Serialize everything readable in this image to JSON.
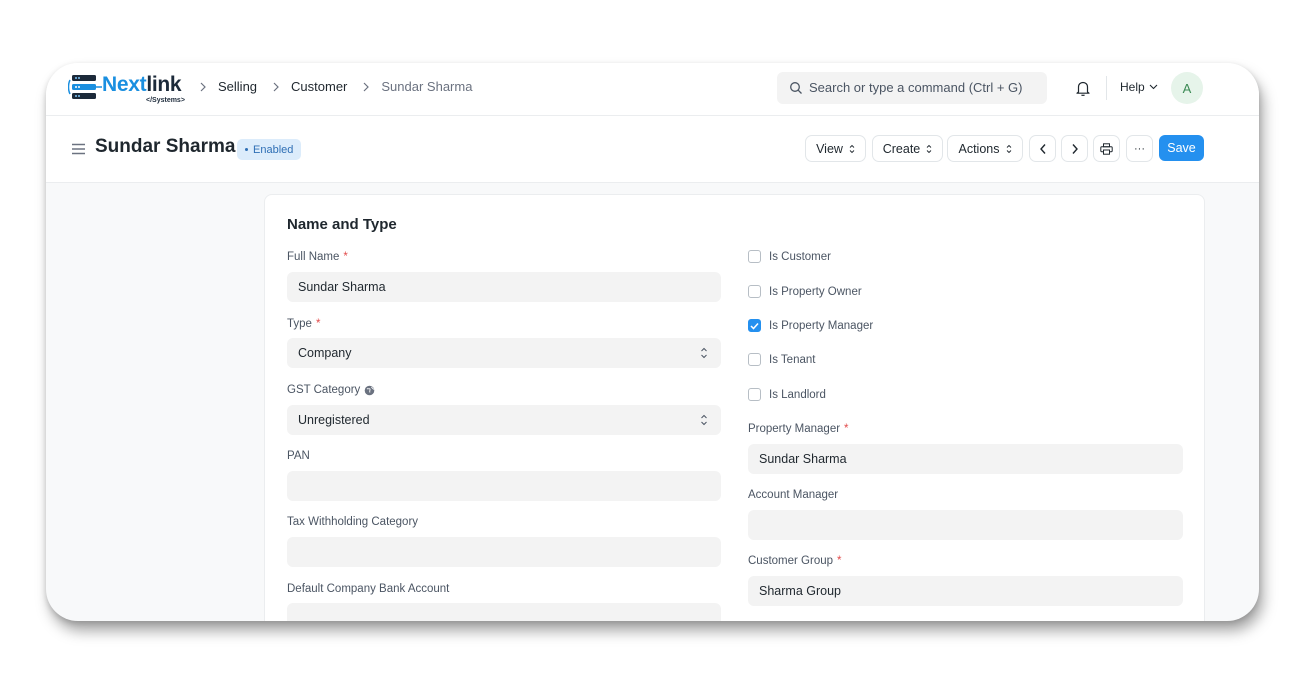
{
  "brand": {
    "name_part1": "Next",
    "name_part2": "link",
    "subtitle": "</Systems>"
  },
  "breadcrumbs": [
    "Selling",
    "Customer",
    "Sundar Sharma"
  ],
  "search": {
    "placeholder": "Search or type a command (Ctrl + G)"
  },
  "navbar": {
    "help_label": "Help",
    "avatar_initial": "A"
  },
  "page": {
    "title": "Sundar Sharma",
    "status": "Enabled",
    "buttons": {
      "view": "View",
      "create": "Create",
      "actions": "Actions",
      "more": "···",
      "save": "Save"
    }
  },
  "form": {
    "section_title": "Name and Type",
    "left_fields": [
      {
        "label": "Full Name",
        "required": true,
        "value": "Sundar Sharma"
      },
      {
        "label": "Type",
        "required": true,
        "value": "Company"
      },
      {
        "label": "GST Category",
        "value": "Unregistered"
      },
      {
        "label": "PAN",
        "value": ""
      },
      {
        "label": "Tax Withholding Category",
        "value": ""
      },
      {
        "label": "Default Company Bank Account",
        "value": ""
      }
    ],
    "checkboxes": [
      {
        "label": "Is Customer",
        "checked": false
      },
      {
        "label": "Is Property Owner",
        "checked": false
      },
      {
        "label": "Is Property Manager",
        "checked": true
      },
      {
        "label": "Is Tenant",
        "checked": false
      },
      {
        "label": "Is Landlord",
        "checked": false
      }
    ],
    "right_fields": [
      {
        "label": "Property Manager",
        "required": true,
        "value": "Sundar Sharma"
      },
      {
        "label": "Account Manager",
        "value": ""
      },
      {
        "label": "Customer Group",
        "required": true,
        "value": "Sharma Group"
      }
    ]
  },
  "colors": {
    "primary": "#2490ef",
    "badge_bg": "#dcecfb",
    "badge_text": "#2f6fb5",
    "required": "#e24c4c"
  }
}
